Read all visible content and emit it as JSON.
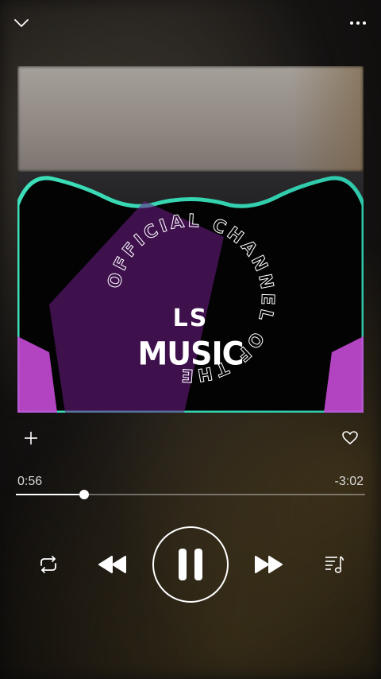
{
  "album_art": {
    "logo_line1": "LS",
    "logo_line2": "MUSIC",
    "ring_text": "OFFICIAL CHANNEL OF THE",
    "accent_colors": [
      "#3de0b8",
      "#c54bd6",
      "#6f1e8a"
    ]
  },
  "player": {
    "elapsed": "0:56",
    "remaining": "-3:02",
    "progress_fraction": 0.195
  },
  "icons": {
    "collapse": "chevron-down-icon",
    "more": "more-icon",
    "add": "plus-icon",
    "like": "heart-icon",
    "repeat": "repeat-icon",
    "previous": "rewind-icon",
    "pause": "pause-icon",
    "next": "fast-forward-icon",
    "queue": "queue-icon"
  }
}
